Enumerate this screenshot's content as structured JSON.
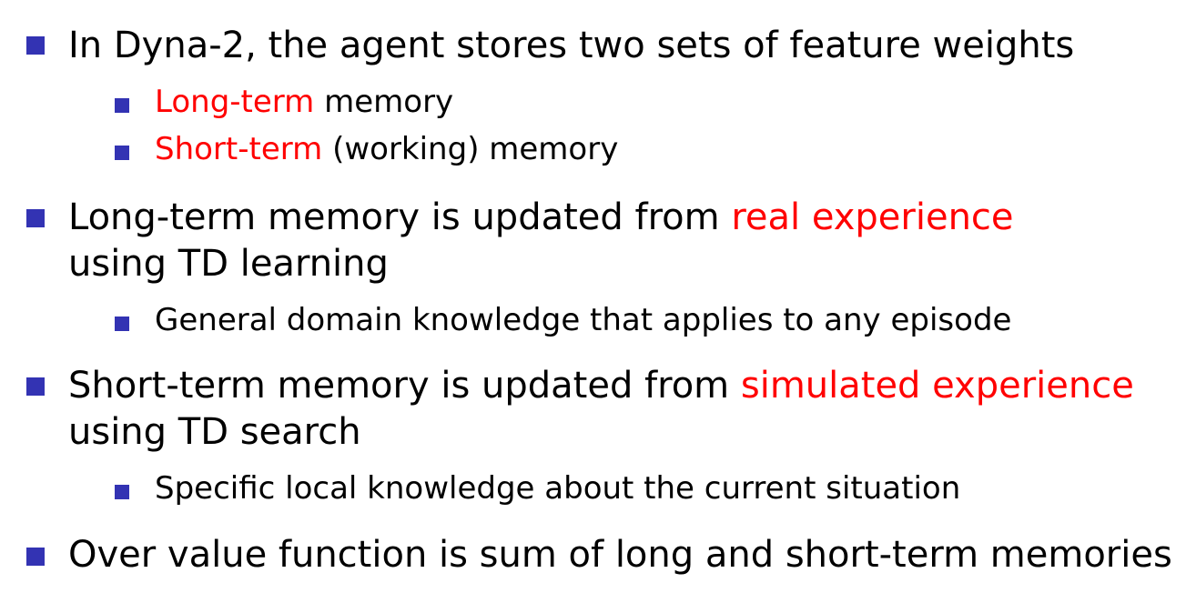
{
  "colors": {
    "bullet": "#3333b3",
    "highlight": "#ff0000",
    "text": "#000000"
  },
  "items": [
    {
      "line1": {
        "pre": "In Dyna-2, the agent stores two sets of feature weights"
      },
      "sub": [
        {
          "highlight": "Long-term",
          "post": " memory"
        },
        {
          "highlight": "Short-term",
          "post": " (working) memory"
        }
      ]
    },
    {
      "line1": {
        "pre": "Long-term memory is updated from ",
        "highlight": "real experience"
      },
      "line2": "using TD learning",
      "sub": [
        {
          "text": "General domain knowledge that applies to any episode"
        }
      ]
    },
    {
      "line1": {
        "pre": "Short-term memory is updated from ",
        "highlight": "simulated experience"
      },
      "line2": "using TD search",
      "sub": [
        {
          "text": "Specific local knowledge about the current situation"
        }
      ]
    },
    {
      "line1": {
        "pre": "Over value function is sum of long and short-term memories"
      }
    }
  ]
}
